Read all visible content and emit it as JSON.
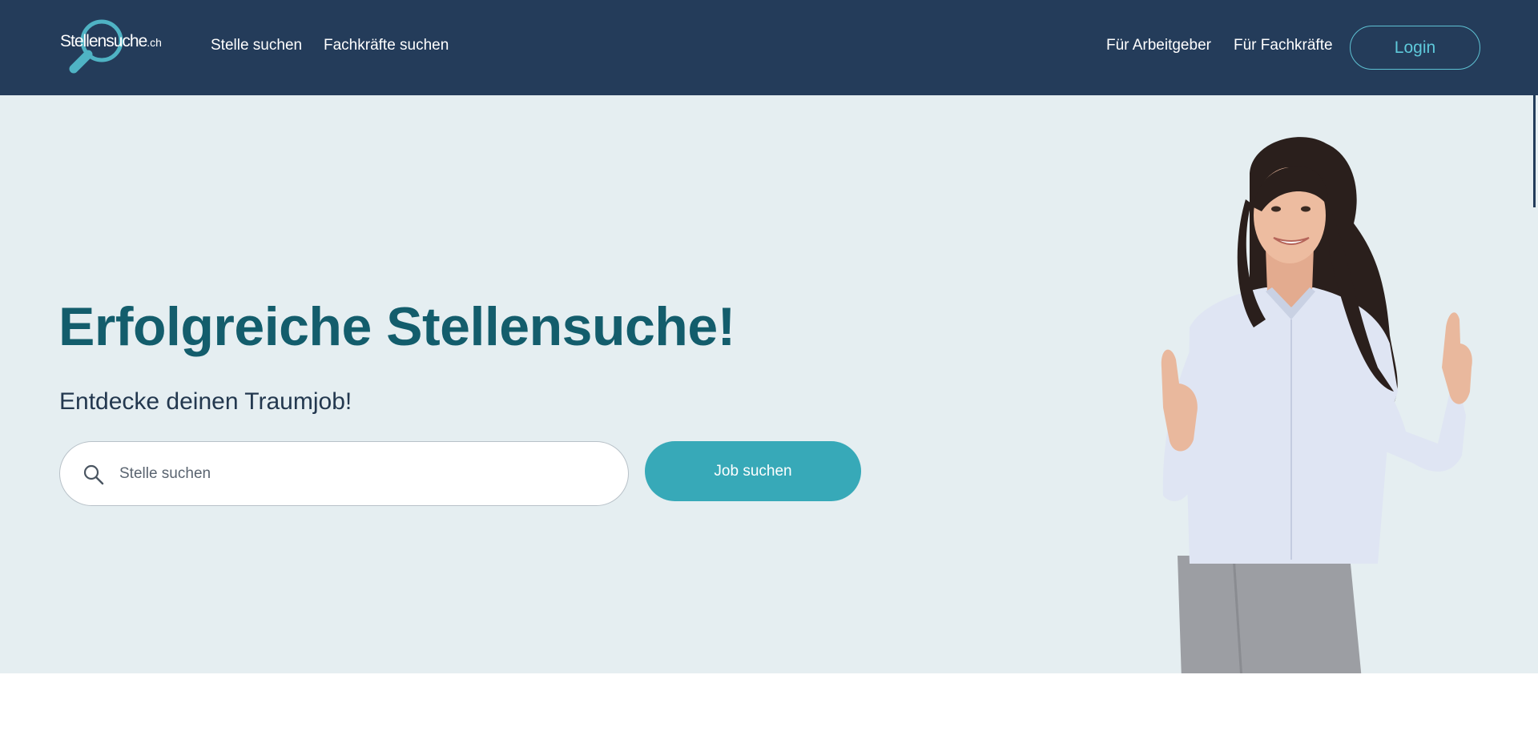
{
  "header": {
    "logo": {
      "main": "Stellensuche",
      "tld": ".ch"
    },
    "nav_left": [
      "Stelle suchen",
      "Fachkräfte suchen"
    ],
    "nav_right": [
      "Für Arbeitgeber",
      "Für Fachkräfte"
    ],
    "login_label": "Login"
  },
  "hero": {
    "title": "Erfolgreiche Stellensuche!",
    "subtitle": "Entdecke deinen Traumjob!",
    "search": {
      "placeholder": "Stelle suchen",
      "value": "",
      "icon": "search-icon"
    },
    "submit_label": "Job suchen"
  },
  "colors": {
    "header_bg": "#243c5a",
    "hero_bg": "#e5eef1",
    "title": "#135d6c",
    "accent": "#37a9b8",
    "login_border": "#5ec1d2"
  }
}
